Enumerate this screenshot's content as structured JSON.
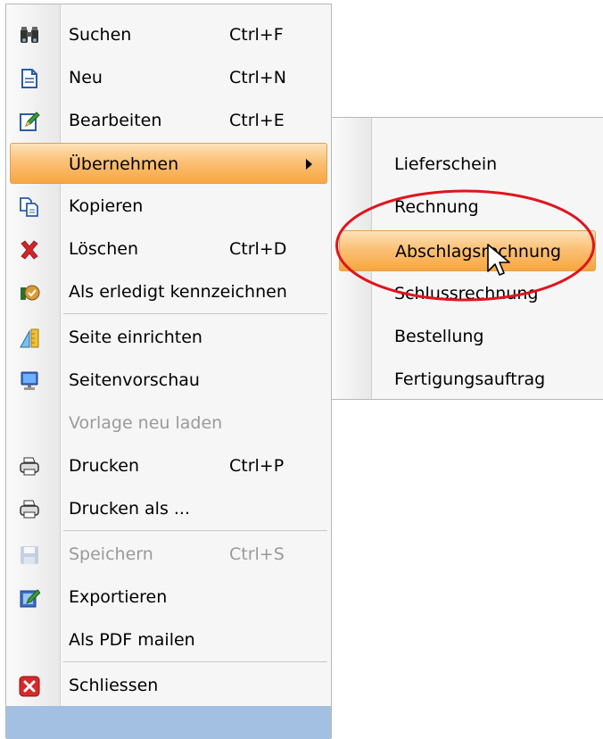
{
  "main_menu": {
    "items": [
      {
        "label": "Suchen",
        "shortcut": "Ctrl+F",
        "icon": "binoculars-icon"
      },
      {
        "label": "Neu",
        "shortcut": "Ctrl+N",
        "icon": "new-document-icon"
      },
      {
        "label": "Bearbeiten",
        "shortcut": "Ctrl+E",
        "icon": "edit-icon"
      },
      {
        "label": "Übernehmen",
        "shortcut": "",
        "icon": "",
        "highlighted": true
      },
      {
        "label": "Kopieren",
        "shortcut": "",
        "icon": "copy-icon"
      },
      {
        "label": "Löschen",
        "shortcut": "Ctrl+D",
        "icon": "delete-icon"
      },
      {
        "label": "Als erledigt kennzeichnen",
        "shortcut": "",
        "icon": "mark-done-icon"
      },
      {
        "label": "Seite einrichten",
        "shortcut": "",
        "icon": "page-setup-icon"
      },
      {
        "label": "Seitenvorschau",
        "shortcut": "",
        "icon": "preview-icon"
      },
      {
        "label": "Vorlage neu laden",
        "shortcut": "",
        "icon": "",
        "disabled": true
      },
      {
        "label": "Drucken",
        "shortcut": "Ctrl+P",
        "icon": "printer-icon"
      },
      {
        "label": "Drucken als ...",
        "shortcut": "",
        "icon": "printer-icon"
      },
      {
        "label": "Speichern",
        "shortcut": "Ctrl+S",
        "icon": "save-icon",
        "disabled": true
      },
      {
        "label": "Exportieren",
        "shortcut": "",
        "icon": "export-icon"
      },
      {
        "label": "Als PDF mailen",
        "shortcut": "",
        "icon": ""
      },
      {
        "label": "Schliessen",
        "shortcut": "",
        "icon": "close-icon"
      }
    ]
  },
  "sub_menu": {
    "items": [
      {
        "label": "Lieferschein"
      },
      {
        "label": "Rechnung"
      },
      {
        "label": "Abschlagsrechnung",
        "highlighted": true
      },
      {
        "label": "Schlussrechnung"
      },
      {
        "label": "Bestellung"
      },
      {
        "label": "Fertigungsauftrag"
      }
    ]
  },
  "colors": {
    "highlight": "#f8a640",
    "annotation": "#e0141e",
    "bottom_bar": "#a3c0e3",
    "delete_red": "#d4242a"
  }
}
